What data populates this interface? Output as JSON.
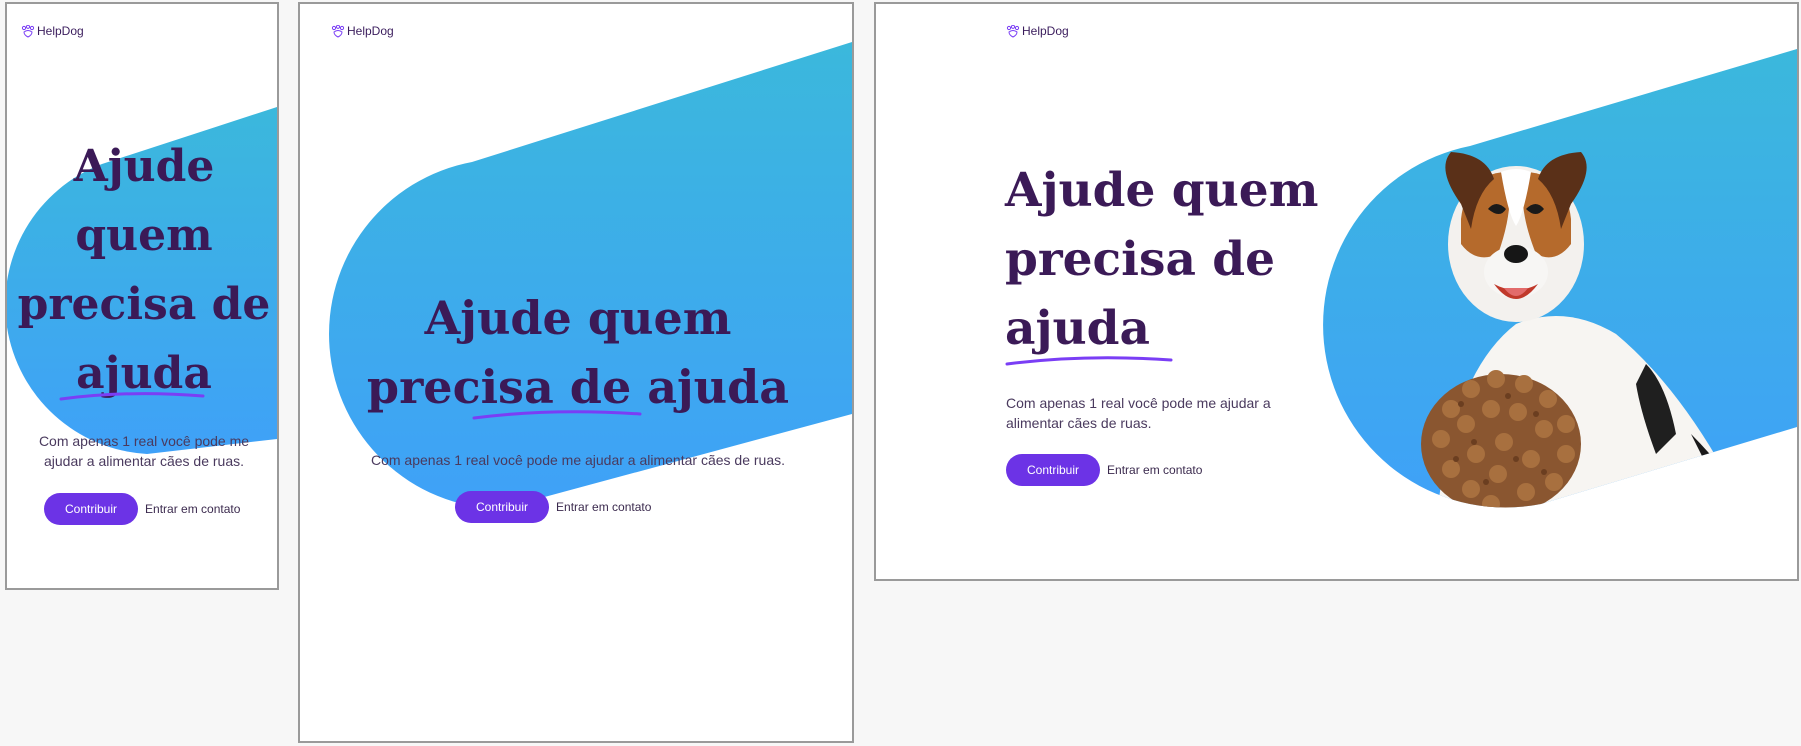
{
  "brand": {
    "name": "HelpDog",
    "logo_icon": "paw-heart-icon"
  },
  "hero": {
    "headline": "Ajude quem precisa de ajuda",
    "description": "Com apenas 1 real você pode me ajudar a alimentar cães de ruas.",
    "primary_button": "Contribuir",
    "secondary_link": "Entrar em contato"
  },
  "colors": {
    "accent": "#6c33e6",
    "headline": "#3b1a57",
    "gradient_top": "#3bb8dc",
    "gradient_bottom": "#3fa1f8",
    "underline": "#7a3ef5"
  }
}
